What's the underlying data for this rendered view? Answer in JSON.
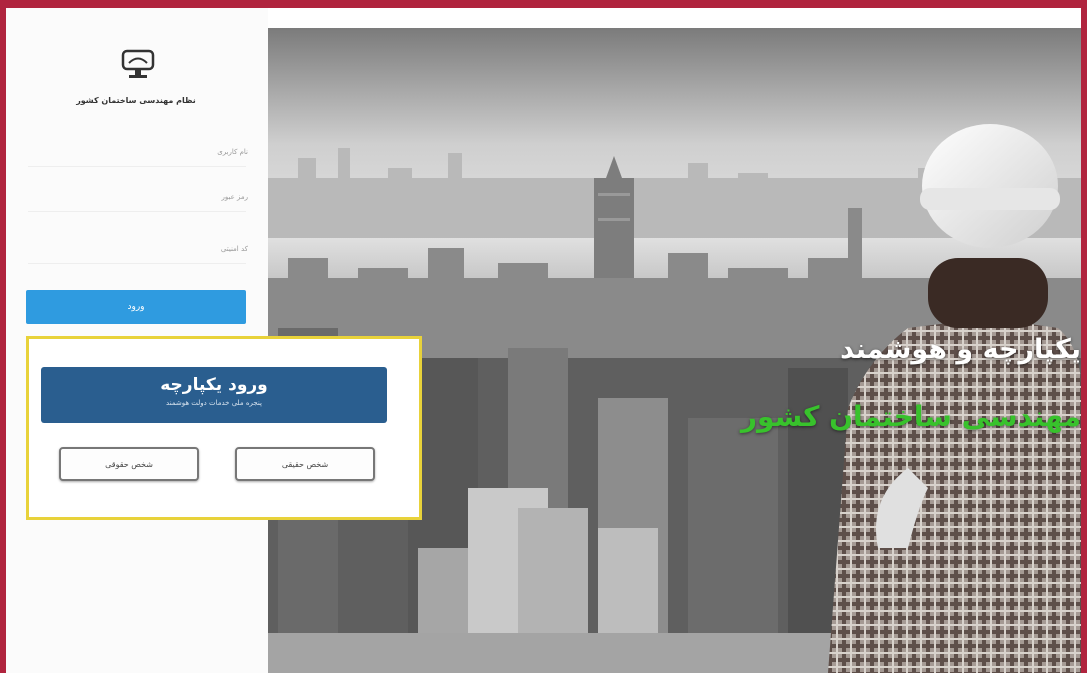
{
  "organization": {
    "name": "نظام مهندسی ساختمان کشور"
  },
  "login": {
    "username_label": "نام کاربری",
    "password_label": "رمز عبور",
    "captcha_label": "کد امنیتی",
    "submit_label": "ورود"
  },
  "sso": {
    "title": "ورود یکپارچه",
    "subtitle": "پنجره ملی خدمات دولت هوشمند",
    "button_left": "شخص حقوقی",
    "button_right": "شخص حقیقی"
  },
  "hero": {
    "headline": "یکپارچه و هوشمند",
    "subheadline": "مهندسی ساختمان کشور"
  },
  "colors": {
    "background": "#b0243e",
    "submit": "#2f9be0",
    "sso_button": "#2a5e8f",
    "highlight": "#e8d23a",
    "subheadline": "#38c22c"
  }
}
